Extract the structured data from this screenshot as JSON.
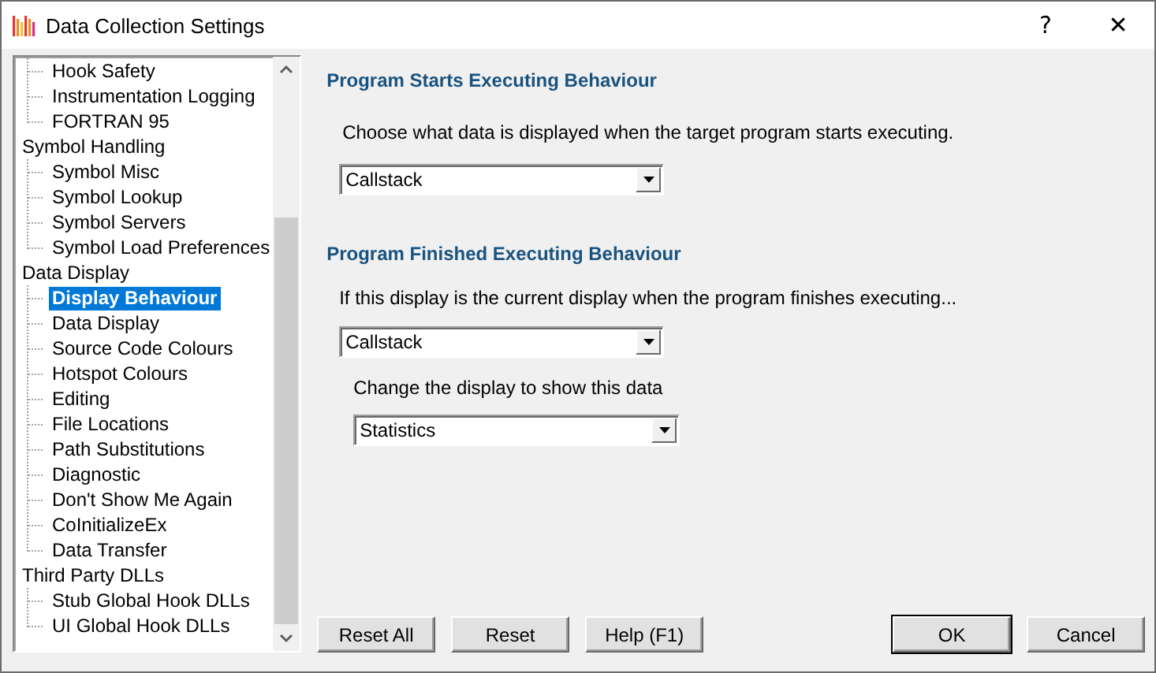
{
  "window": {
    "title": "Data Collection Settings",
    "help": "?",
    "close": "✕"
  },
  "tree": {
    "continued_children": [
      {
        "label": "Hook Safety",
        "selected": false
      },
      {
        "label": "Instrumentation Logging",
        "selected": false
      },
      {
        "label": "FORTRAN 95",
        "selected": false
      }
    ],
    "items": [
      {
        "label": "Symbol Handling",
        "selected": false,
        "children": [
          {
            "label": "Symbol Misc",
            "selected": false
          },
          {
            "label": "Symbol Lookup",
            "selected": false
          },
          {
            "label": "Symbol Servers",
            "selected": false
          },
          {
            "label": "Symbol Load Preferences",
            "selected": false
          }
        ]
      },
      {
        "label": "Data Display",
        "selected": false,
        "children": [
          {
            "label": "Display Behaviour",
            "selected": true
          },
          {
            "label": "Data Display",
            "selected": false
          },
          {
            "label": "Source Code Colours",
            "selected": false
          },
          {
            "label": "Hotspot Colours",
            "selected": false
          },
          {
            "label": "Editing",
            "selected": false
          },
          {
            "label": "File Locations",
            "selected": false
          },
          {
            "label": "Path Substitutions",
            "selected": false
          },
          {
            "label": "Diagnostic",
            "selected": false
          },
          {
            "label": "Don't Show Me Again",
            "selected": false
          },
          {
            "label": "CoInitializeEx",
            "selected": false
          },
          {
            "label": "Data Transfer",
            "selected": false
          }
        ]
      },
      {
        "label": "Third Party DLLs",
        "selected": false,
        "children": [
          {
            "label": "Stub Global Hook DLLs",
            "selected": false
          },
          {
            "label": "UI Global Hook DLLs",
            "selected": false
          }
        ]
      }
    ]
  },
  "starts_section": {
    "heading": "Program Starts Executing Behaviour",
    "description": "Choose what data is displayed when the target program starts executing.",
    "dropdown": {
      "value": "Callstack"
    }
  },
  "finished_section": {
    "heading": "Program Finished Executing Behaviour",
    "description": "If this display is the current display when the program finishes executing...",
    "dropdown": {
      "value": "Callstack"
    },
    "change_label": "Change the display to show this data",
    "change_dropdown": {
      "value": "Statistics"
    }
  },
  "buttons": [
    {
      "label": "Reset All",
      "default": false
    },
    {
      "label": "Reset",
      "default": false
    },
    {
      "label": "Help (F1)",
      "default": false
    },
    {
      "label": "OK",
      "default": true
    },
    {
      "label": "Cancel",
      "default": false
    }
  ]
}
